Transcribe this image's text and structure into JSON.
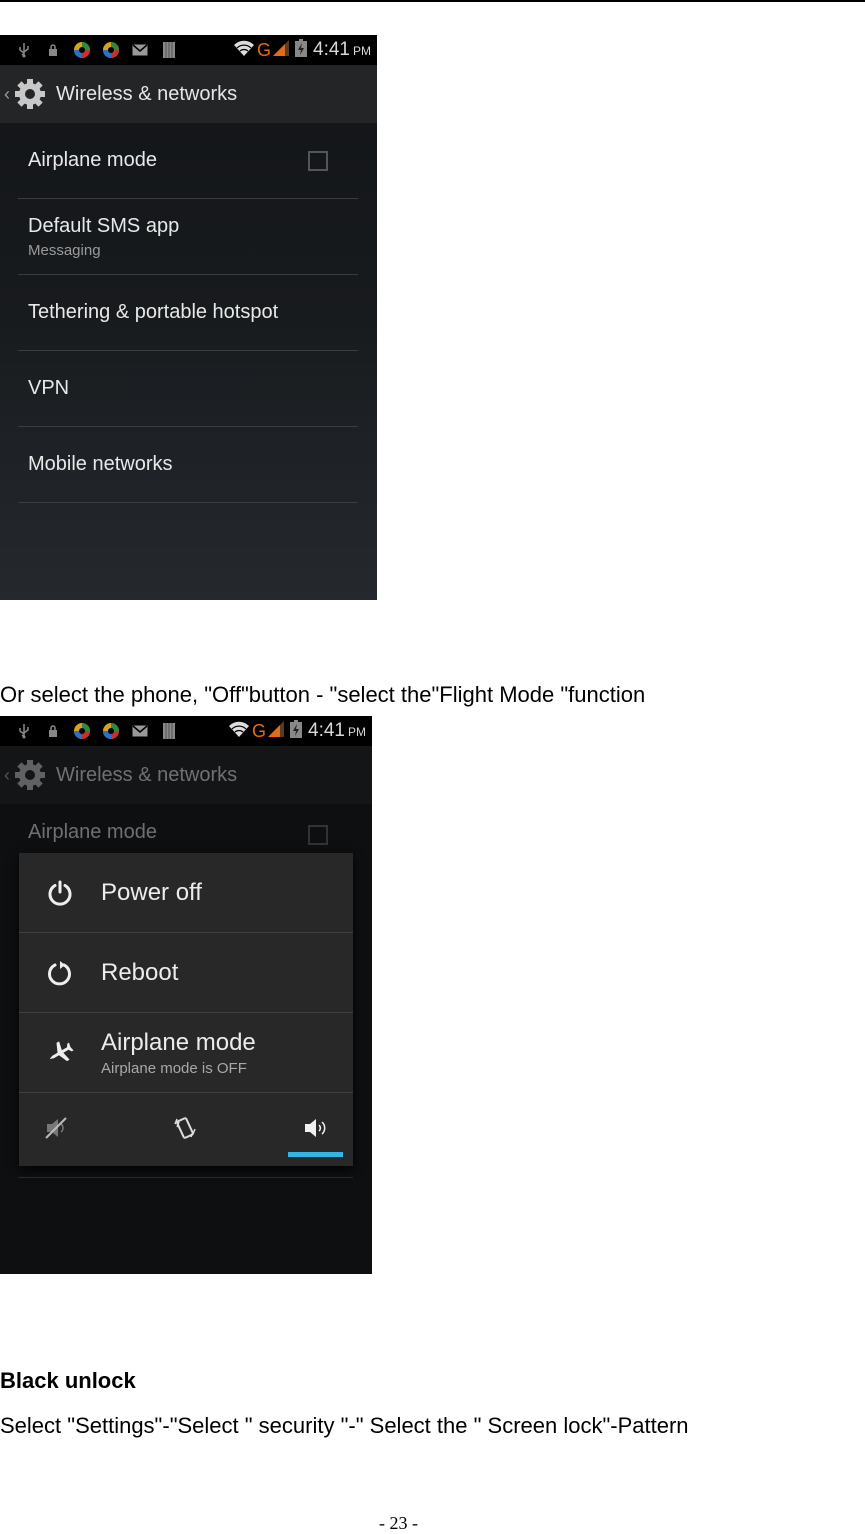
{
  "phone_screens": [
    {
      "status_bar": {
        "left_icons": [
          "usb-icon",
          "lock-icon",
          "chrome-like-app-icon",
          "chrome-like-app-icon",
          "mail-icon",
          "barcode-icon"
        ],
        "right_icons": [
          "wifi-icon",
          "signal-icon",
          "battery-charging-icon"
        ],
        "network_type": "G",
        "time": "4:41",
        "ampm": "PM"
      },
      "action_bar": {
        "title": "Wireless & networks"
      },
      "settings_list": [
        {
          "title": "Airplane mode",
          "has_checkbox": true,
          "checked": false
        },
        {
          "title": "Default SMS app",
          "subtitle": "Messaging"
        },
        {
          "title": "Tethering & portable hotspot"
        },
        {
          "title": "VPN"
        },
        {
          "title": "Mobile networks"
        }
      ]
    },
    {
      "status_bar": {
        "network_type": "G",
        "time": "4:41",
        "ampm": "PM"
      },
      "action_bar": {
        "title": "Wireless & networks"
      },
      "background_item": {
        "title": "Airplane mode",
        "checked": false
      },
      "power_dialog": {
        "items": [
          {
            "icon": "power-icon",
            "title": "Power off"
          },
          {
            "icon": "reboot-icon",
            "title": "Reboot"
          },
          {
            "icon": "airplane-icon",
            "title": "Airplane mode",
            "subtitle": "Airplane mode is OFF"
          }
        ],
        "sound_modes": [
          "silent",
          "vibrate",
          "sound"
        ],
        "selected_sound_mode": "sound",
        "accent_color": "#33b5e5"
      }
    }
  ],
  "text": {
    "caption": "Or select the phone, \"Off\"button - \"select the\"Flight Mode \"function",
    "heading": "Black unlock",
    "body": "Select \"Settings\"-\"Select \" security \"-\" Select the \" Screen lock\"-Pattern",
    "page_number": "- 23 -"
  }
}
